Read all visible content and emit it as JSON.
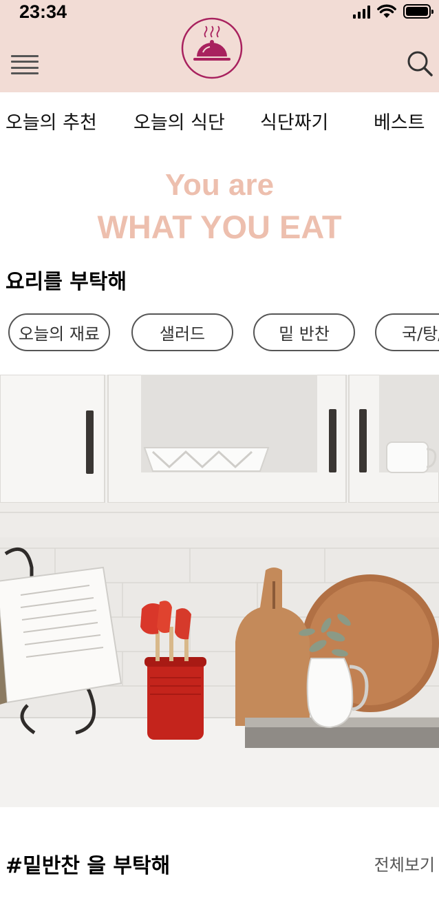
{
  "status_bar": {
    "time": "23:34"
  },
  "header": {
    "menu_icon": "hamburger-icon",
    "logo_icon": "cloche-icon",
    "search_icon": "search-icon"
  },
  "nav": {
    "items": [
      "오늘의 추천",
      "오늘의 식단",
      "식단짜기",
      "베스트"
    ]
  },
  "slogan": {
    "line1": "You are",
    "line2": "WHAT YOU EAT",
    "color": "#edbfae"
  },
  "request_section": {
    "title": "요리를 부탁해",
    "chips": [
      "오늘의 재료",
      "샐러드",
      "밑 반찬",
      "국/탕/"
    ]
  },
  "hero_image": {
    "description_icon": "kitchen-counter-photo"
  },
  "side_dish_section": {
    "title": "#밑반찬 을 부탁해",
    "see_all": "전체보기"
  },
  "colors": {
    "header_bg": "#f2dcd5",
    "brand": "#a8215e",
    "accent": "#edbfae"
  }
}
